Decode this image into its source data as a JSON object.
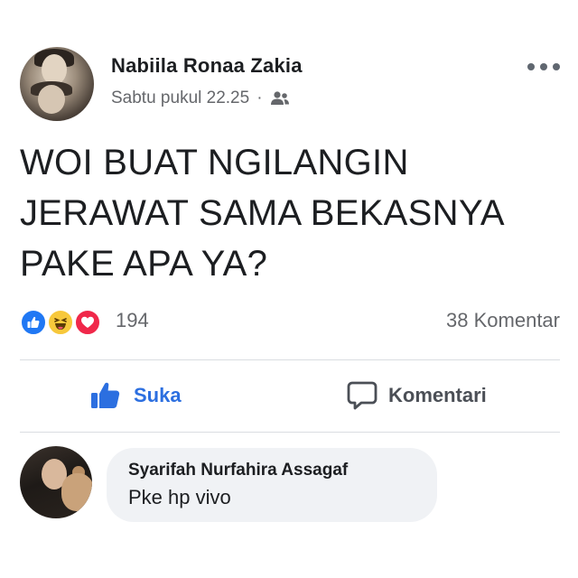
{
  "post": {
    "author": "Nabiila Ronaa Zakia",
    "timestamp": "Sabtu pukul 22.25",
    "separator": "·",
    "audience_icon": "friends-icon",
    "text_lines": [
      "WOI BUAT NGILANGIN",
      "JERAWAT SAMA BEKASNYA",
      "PAKE APA YA?"
    ]
  },
  "reactions": {
    "types": [
      "like",
      "haha",
      "love"
    ],
    "count": "194",
    "comments_count": "38 Komentar"
  },
  "actions": {
    "like_label": "Suka",
    "comment_label": "Komentari"
  },
  "comment": {
    "author": "Syarifah Nurfahira Assagaf",
    "text": "Pke hp vivo"
  },
  "colors": {
    "like_blue": "#2c6fe0",
    "secondary_text": "#65676b",
    "bubble_bg": "#f0f2f5"
  }
}
